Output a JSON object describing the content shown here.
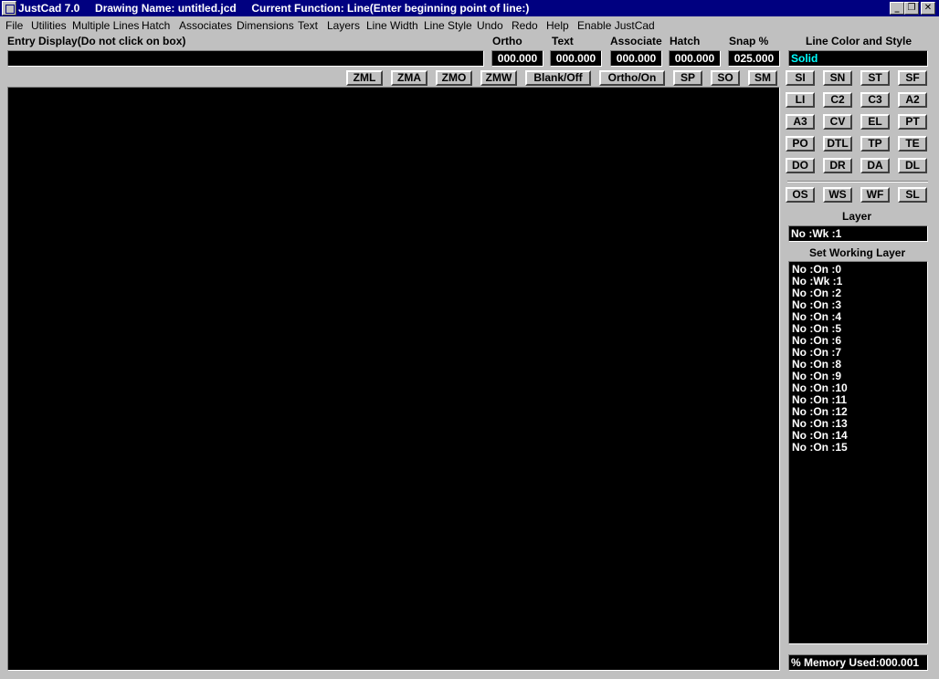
{
  "window": {
    "title": "JustCad 7.0     Drawing Name: untitled.jcd     Current Function: Line(Enter beginning point of line:)",
    "min_glyph": "_",
    "max_glyph": "❐",
    "close_glyph": "✕"
  },
  "menu": [
    "File",
    "Utilities",
    "Multiple Lines",
    "Hatch",
    "Associates",
    "Dimensions",
    "Text",
    "Layers",
    "Line Width",
    "Line Style",
    "Undo",
    "Redo",
    "Help",
    "Enable JustCad"
  ],
  "entry": {
    "label": "Entry Display(Do not click on box)",
    "value": ""
  },
  "fields": {
    "ortho": {
      "label": "Ortho",
      "value": "000.000"
    },
    "text": {
      "label": "Text",
      "value": "000.000"
    },
    "associate": {
      "label": "Associate",
      "value": "000.000"
    },
    "hatch": {
      "label": "Hatch",
      "value": "000.000"
    },
    "snap": {
      "label": "Snap %",
      "value": "025.000"
    }
  },
  "line_color": {
    "label": "Line Color and Style",
    "value": "Solid",
    "color": "#00ffff"
  },
  "toolbar": [
    "ZML",
    "ZMA",
    "ZMO",
    "ZMW",
    "Blank/Off",
    "Ortho/On",
    "SP",
    "SO",
    "SM"
  ],
  "tools": [
    "SI",
    "SN",
    "ST",
    "SF",
    "LI",
    "C2",
    "C3",
    "A2",
    "A3",
    "CV",
    "EL",
    "PT",
    "PO",
    "DTL",
    "TP",
    "TE",
    "DO",
    "DR",
    "DA",
    "DL"
  ],
  "tools2": [
    "OS",
    "WS",
    "WF",
    "SL"
  ],
  "layer": {
    "label": "Layer",
    "value": "No :Wk :1"
  },
  "working_layer": {
    "label": "Set Working Layer",
    "items": [
      "No :On :0",
      "No :Wk :1",
      "No :On :2",
      "No :On :3",
      "No :On :4",
      "No :On :5",
      "No :On :6",
      "No :On :7",
      "No :On :8",
      "No :On :9",
      "No :On :10",
      "No :On :11",
      "No :On :12",
      "No :On :13",
      "No :On :14",
      "No :On :15"
    ]
  },
  "memory": "% Memory Used:000.001"
}
